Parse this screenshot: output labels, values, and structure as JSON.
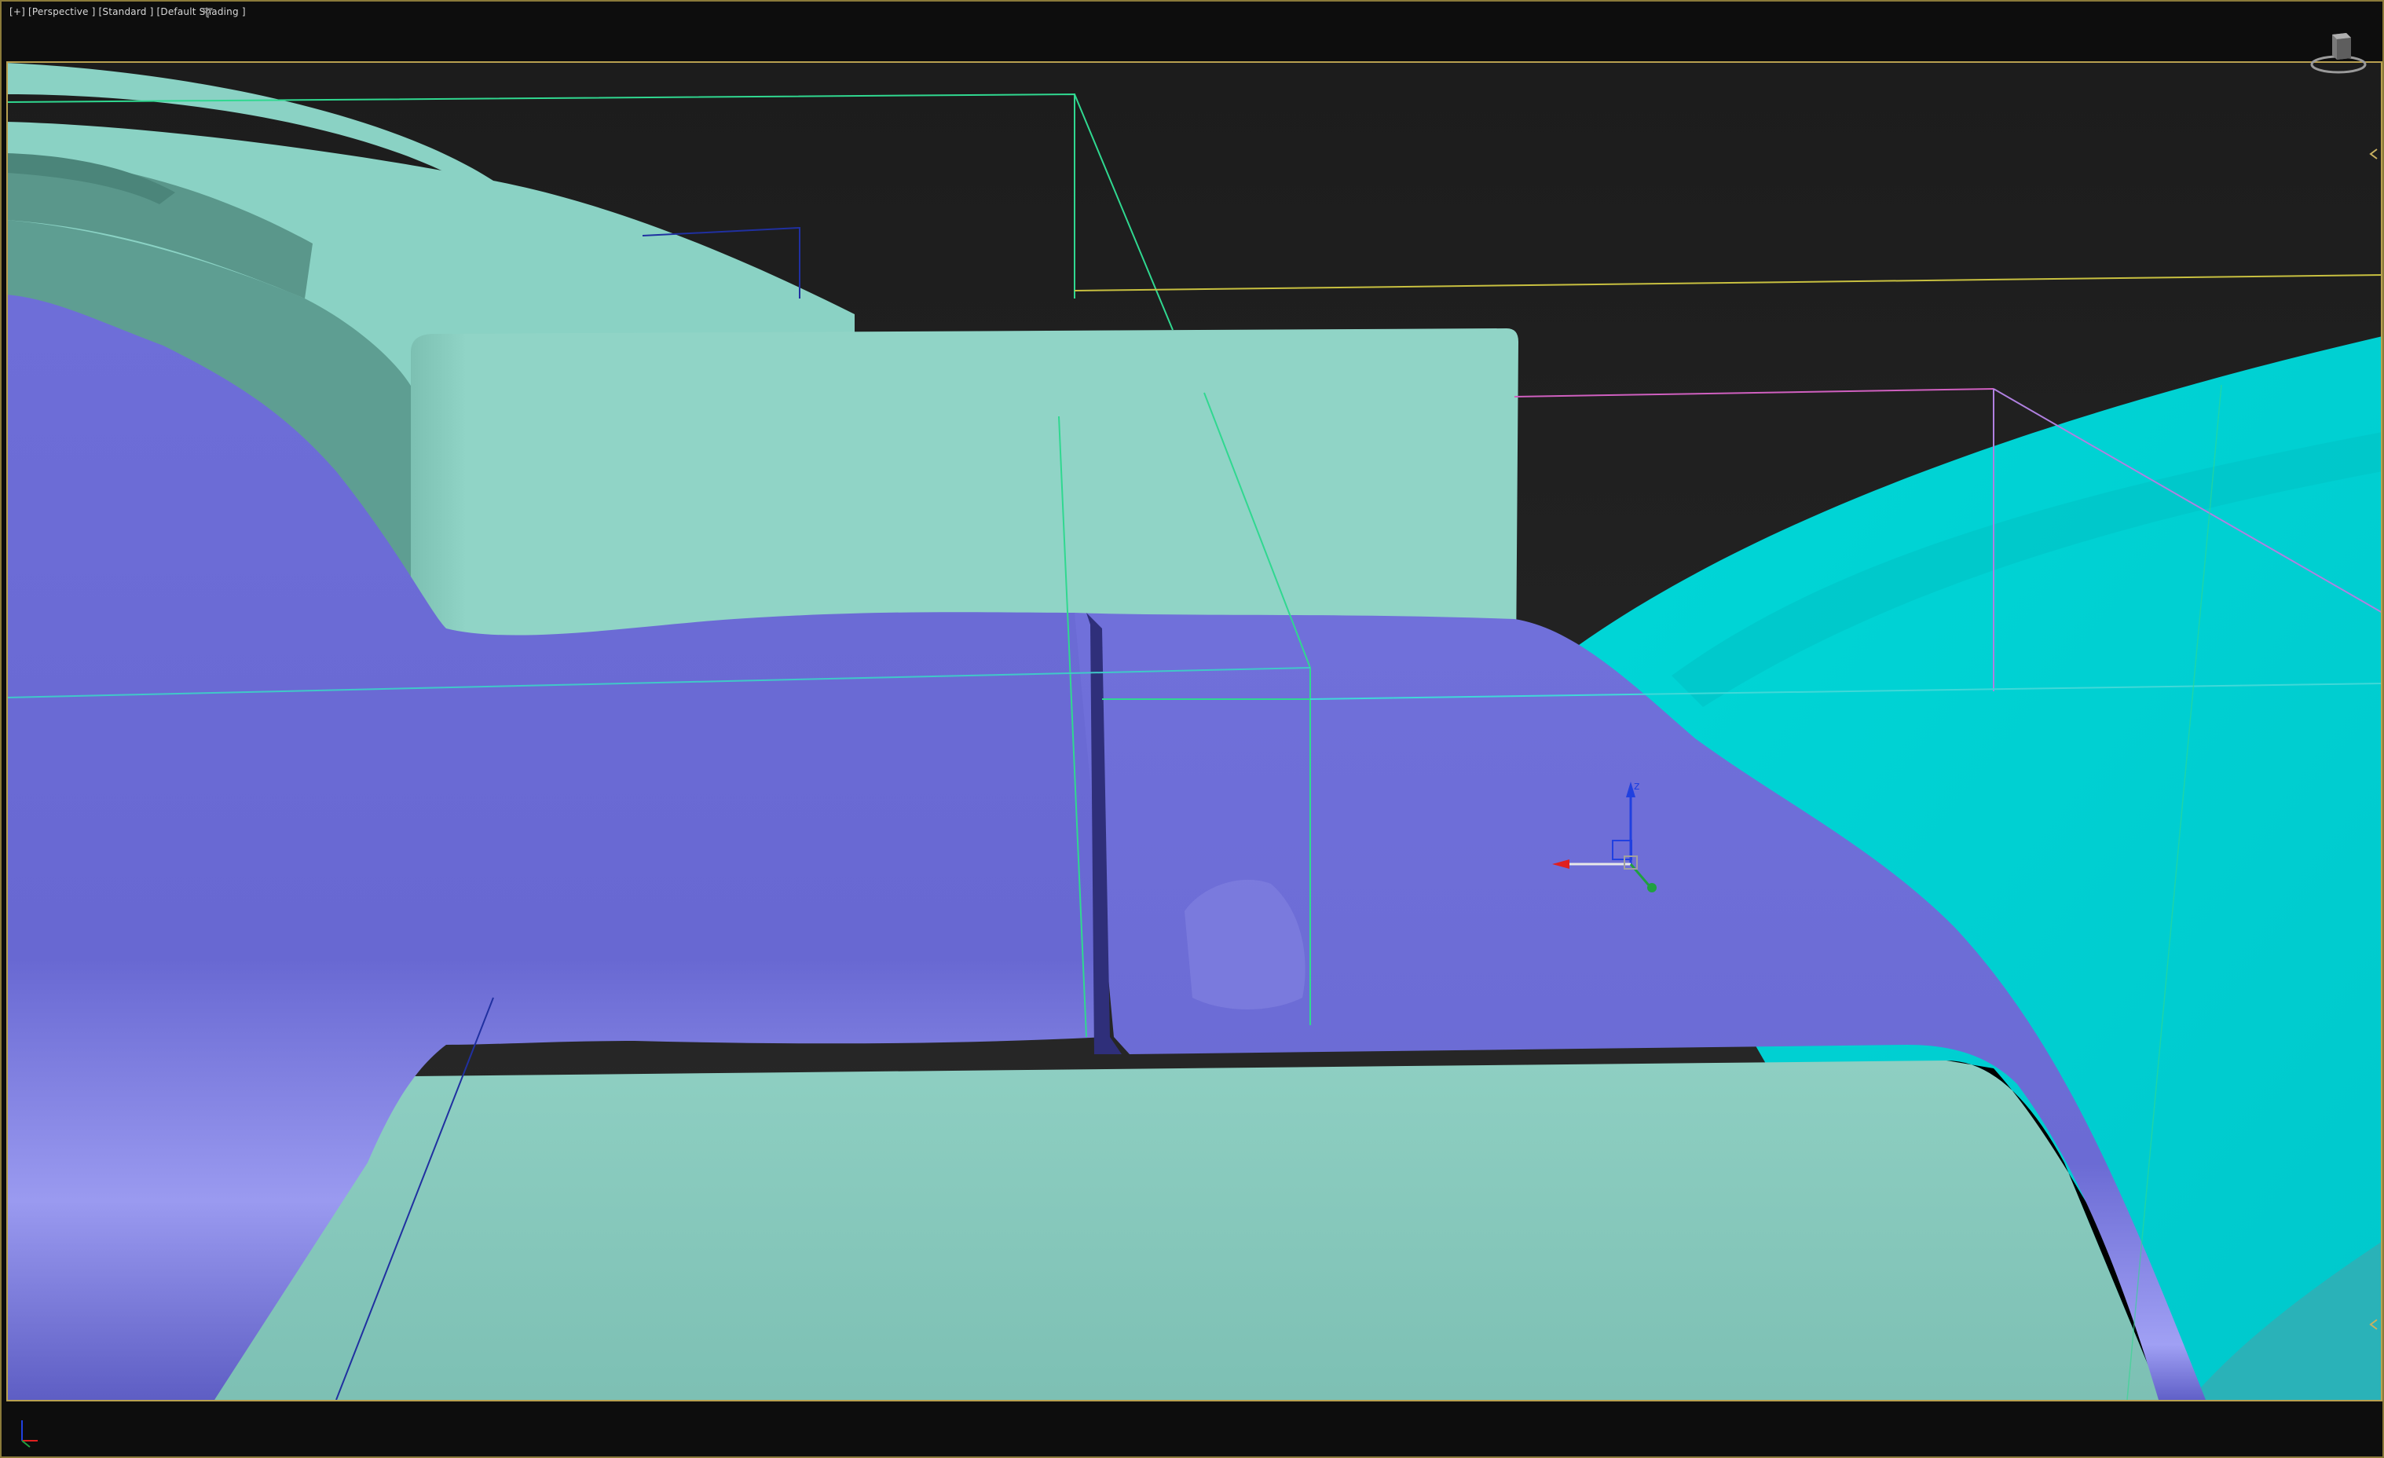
{
  "viewport": {
    "label": "[+] [Perspective ] [Standard ] [Default Shading ]",
    "filter_icon": "filter-icon",
    "viewcube_icon": "viewcube-icon",
    "axis_tripod_icon": "world-axis-icon"
  },
  "gizmo": {
    "axis_labels": {
      "x": "",
      "y": "",
      "z": "z"
    },
    "colors": {
      "x": "#e02020",
      "y": "#20a040",
      "z": "#2040e0"
    }
  },
  "colors": {
    "background": "#212121",
    "floor": "#86c8bc",
    "wall": "#8ed4c4",
    "ramp": "#6a6ad8",
    "cylinder": "#00d2d2",
    "safe_frame": "#b8a050"
  }
}
